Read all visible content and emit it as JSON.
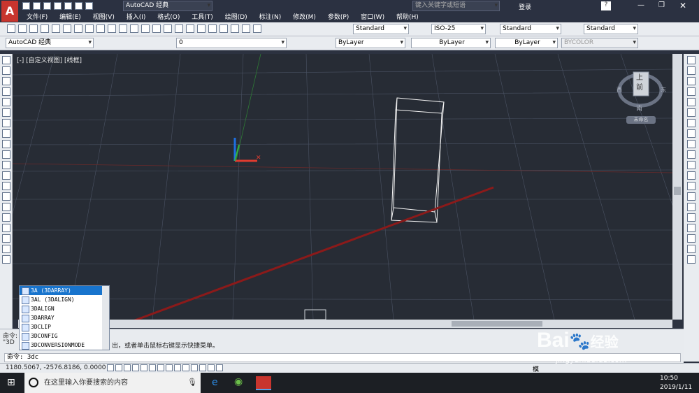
{
  "titlebar": {
    "workspace": "AutoCAD 经典",
    "search_placeholder": "键入关键字或短语",
    "login": "登录",
    "help": "?"
  },
  "menu": [
    "文件(F)",
    "编辑(E)",
    "视图(V)",
    "插入(I)",
    "格式(O)",
    "工具(T)",
    "绘图(D)",
    "标注(N)",
    "修改(M)",
    "参数(P)",
    "窗口(W)",
    "帮助(H)"
  ],
  "styles": {
    "text": "Standard",
    "dim": "ISO-25",
    "table": "Standard",
    "multileader": "Standard"
  },
  "workspace_combo": "AutoCAD 经典",
  "layer": "0",
  "properties": {
    "color": "ByLayer",
    "linetype": "ByLayer",
    "lineweight": "ByLayer",
    "plotstyle": "BYCOLOR"
  },
  "viewport": {
    "label": "[-] [自定义视图] [线框]"
  },
  "viewcube": {
    "top": "上",
    "front": "前",
    "west": "西",
    "east": "东",
    "south": "南",
    "wcs": "未命名"
  },
  "command": {
    "history_line": "命令:",
    "history_partial": "\"3D",
    "prompt_tail": "出，或者单击鼠标右键显示快捷菜单。",
    "input": "命令: 3dc"
  },
  "autocomplete": [
    "3A (3DARRAY)",
    "3AL (3DALIGN)",
    "3DALIGN",
    "3DARRAY",
    "3DCLIP",
    "3DCONFIG",
    "3DCONVERSIONMODE"
  ],
  "status": {
    "coords": "1180.5067,  -2576.8186,  0.0000",
    "model": "模"
  },
  "taskbar": {
    "search": "在这里输入你要搜索的内容",
    "time": "10:50",
    "date": "2019/1/11"
  },
  "watermark": {
    "brand": "Bai",
    "suffix": "经验",
    "url": "jingyan.baidu.com"
  },
  "colors": {
    "background": "#272c35",
    "annotation_arrow": "#8b1a1a",
    "x_axis": "#e03b2f",
    "y_axis": "#34b23f",
    "z_axis": "#1e6fe0"
  }
}
